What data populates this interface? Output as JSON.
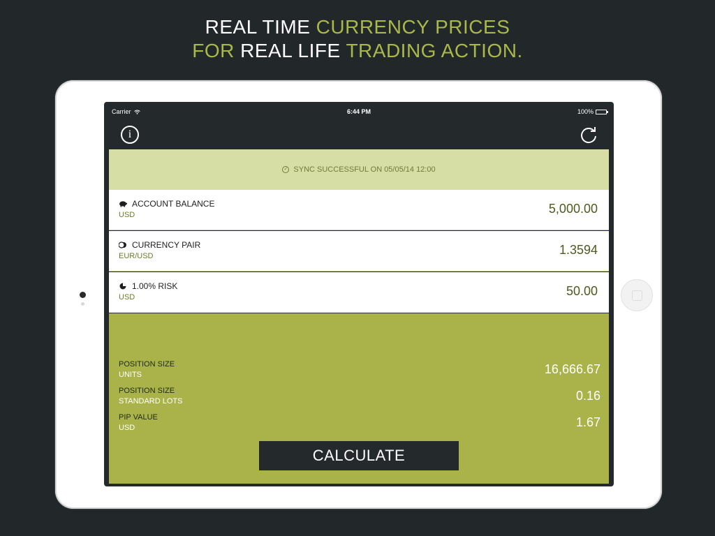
{
  "headline": {
    "line1_white": "REAL TIME",
    "line1_green": "CURRENCY PRICES",
    "line2_green_a": "FOR",
    "line2_white": "REAL LIFE",
    "line2_green_b": "TRADING ACTION."
  },
  "status_bar": {
    "carrier": "Carrier",
    "time": "6:44 PM",
    "battery": "100%"
  },
  "navbar": {
    "info_icon": "info-icon",
    "refresh_icon": "refresh-icon"
  },
  "sync": {
    "text": "SYNC SUCCESSFUL ON 05/05/14 12:00"
  },
  "inputs": [
    {
      "icon": "piggy-bank-icon",
      "title": "ACCOUNT BALANCE",
      "sub": "USD",
      "value": "5,000.00"
    },
    {
      "icon": "coins-icon",
      "title": "CURRENCY PAIR",
      "sub": "EUR/USD",
      "value": "1.3594"
    },
    {
      "icon": "pie-chart-icon",
      "title": "1.00% RISK",
      "sub": "USD",
      "value": "50.00"
    }
  ],
  "results": [
    {
      "label": "POSITION SIZE",
      "sub": "UNITS",
      "value": "16,666.67"
    },
    {
      "label": "POSITION SIZE",
      "sub": "STANDARD LOTS",
      "value": "0.16"
    },
    {
      "label": "PIP VALUE",
      "sub": "USD",
      "value": "1.67"
    }
  ],
  "calculate_label": "CALCULATE",
  "colors": {
    "background": "#22282a",
    "accent_green": "#a9b84a",
    "sync_bg": "#d6dea6",
    "results_bg": "#a9b34a",
    "dark": "#24292b"
  }
}
